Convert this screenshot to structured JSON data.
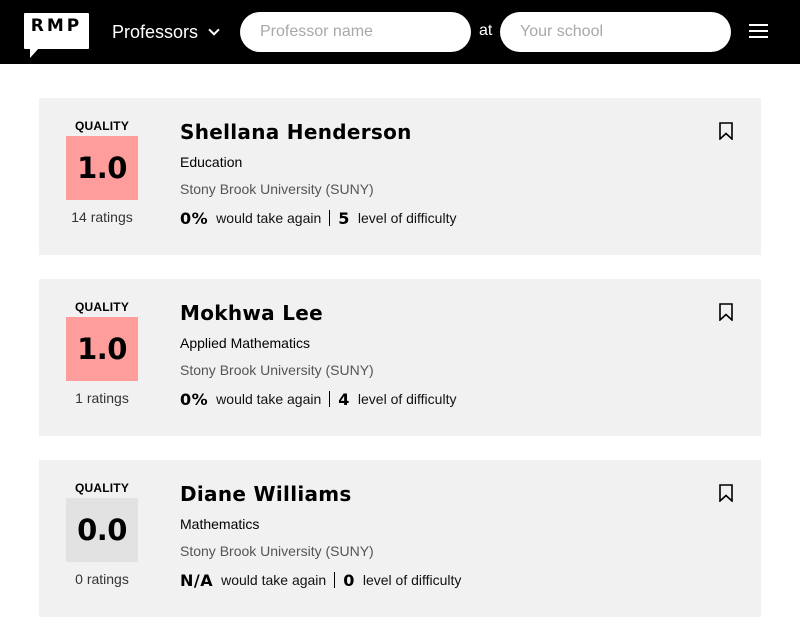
{
  "header": {
    "logo_text": "RMP",
    "search_type": "Professors",
    "professor_placeholder": "Professor name",
    "at_label": "at",
    "school_placeholder": "Your school"
  },
  "colors": {
    "header_bg": "#000000",
    "card_bg": "#f1f1f1",
    "quality_low": "#ff9c9c",
    "quality_none": "#e2e2e2"
  },
  "icons": {
    "logo": "rmp-logo",
    "dropdown": "chevron-down-icon",
    "menu": "hamburger-menu-icon",
    "save": "bookmark-icon"
  },
  "results": [
    {
      "quality_label": "QUALITY",
      "quality": "1.0",
      "quality_color": "#ff9c9c",
      "ratings": "14 ratings",
      "name": "Shellana Henderson",
      "department": "Education",
      "school": "Stony Brook University (SUNY)",
      "take_again": "0%",
      "take_again_label": "would take again",
      "difficulty": "5",
      "difficulty_label": "level of difficulty"
    },
    {
      "quality_label": "QUALITY",
      "quality": "1.0",
      "quality_color": "#ff9c9c",
      "ratings": "1 ratings",
      "name": "Mokhwa Lee",
      "department": "Applied Mathematics",
      "school": "Stony Brook University (SUNY)",
      "take_again": "0%",
      "take_again_label": "would take again",
      "difficulty": "4",
      "difficulty_label": "level of difficulty"
    },
    {
      "quality_label": "QUALITY",
      "quality": "0.0",
      "quality_color": "#e2e2e2",
      "ratings": "0 ratings",
      "name": "Diane Williams",
      "department": "Mathematics",
      "school": "Stony Brook University (SUNY)",
      "take_again": "N/A",
      "take_again_label": "would take again",
      "difficulty": "0",
      "difficulty_label": "level of difficulty"
    }
  ]
}
